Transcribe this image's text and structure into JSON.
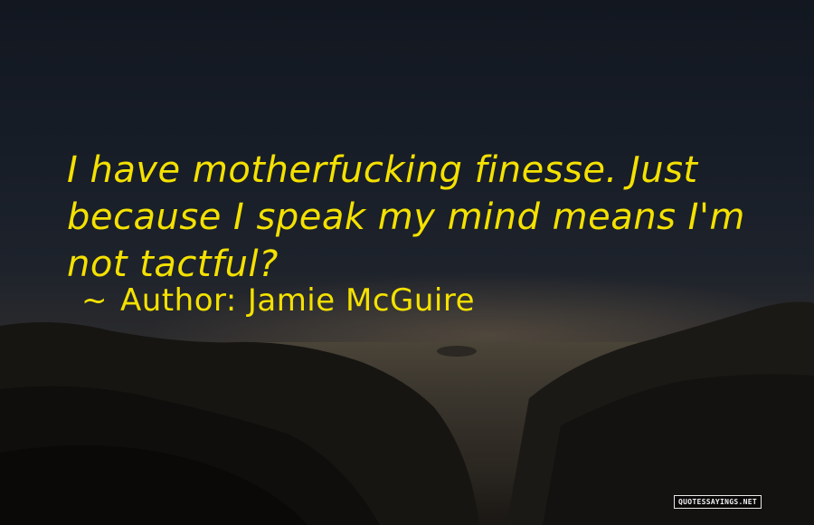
{
  "quote": {
    "lines": [
      "I have motherfucking finesse. Just",
      "because I speak my mind means I'm",
      "not tactful?"
    ],
    "author_prefix": "~",
    "author_label": "Author:",
    "author_name": "Jamie McGuire"
  },
  "watermark": "QUOTESSAYINGS.NET",
  "colors": {
    "quote_text": "#f4e100"
  }
}
